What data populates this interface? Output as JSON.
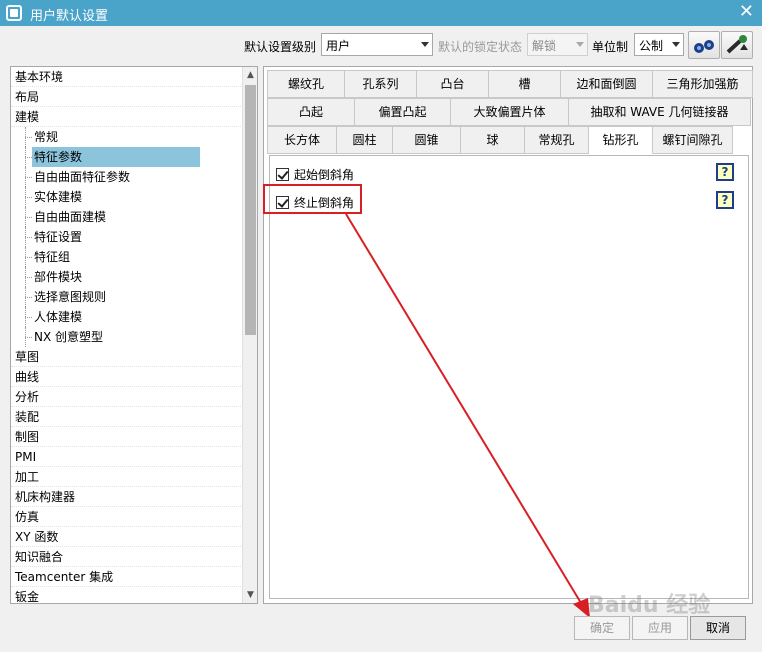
{
  "window": {
    "title": "用户默认设置",
    "close_label": "✕"
  },
  "toolbar": {
    "level_label": "默认设置级别",
    "level_value": "用户",
    "lock_label": "默认的锁定状态",
    "lock_value": "解锁",
    "unit_label": "单位制",
    "unit_value": "公制"
  },
  "tree": {
    "items": [
      {
        "label": "基本环境",
        "level": 0
      },
      {
        "label": "布局",
        "level": 0
      },
      {
        "label": "建模",
        "level": 0
      },
      {
        "label": "常规",
        "level": 1
      },
      {
        "label": "特征参数",
        "level": 1,
        "selected": true
      },
      {
        "label": "自由曲面特征参数",
        "level": 1
      },
      {
        "label": "实体建模",
        "level": 1
      },
      {
        "label": "自由曲面建模",
        "level": 1
      },
      {
        "label": "特征设置",
        "level": 1
      },
      {
        "label": "特征组",
        "level": 1
      },
      {
        "label": "部件模块",
        "level": 1
      },
      {
        "label": "选择意图规则",
        "level": 1
      },
      {
        "label": "人体建模",
        "level": 1
      },
      {
        "label": "NX 创意塑型",
        "level": 1
      },
      {
        "label": "草图",
        "level": 0
      },
      {
        "label": "曲线",
        "level": 0
      },
      {
        "label": "分析",
        "level": 0
      },
      {
        "label": "装配",
        "level": 0
      },
      {
        "label": "制图",
        "level": 0
      },
      {
        "label": "PMI",
        "level": 0
      },
      {
        "label": "加工",
        "level": 0
      },
      {
        "label": "机床构建器",
        "level": 0
      },
      {
        "label": "仿真",
        "level": 0
      },
      {
        "label": "XY 函数",
        "level": 0
      },
      {
        "label": "知识融合",
        "level": 0
      },
      {
        "label": "Teamcenter 集成",
        "level": 0
      },
      {
        "label": "钣金",
        "level": 0
      }
    ]
  },
  "tabs": {
    "row1": [
      "螺纹孔",
      "孔系列",
      "凸台",
      "槽",
      "边和面倒圆",
      "三角形加强筋"
    ],
    "row2": [
      "凸起",
      "偏置凸起",
      "大致偏置片体",
      "抽取和 WAVE 几何链接器"
    ],
    "row3": [
      "长方体",
      "圆柱",
      "圆锥",
      "球",
      "常规孔",
      "钻形孔",
      "螺钉间隙孔"
    ],
    "active": "钻形孔"
  },
  "options": [
    {
      "label": "起始倒斜角",
      "checked": true,
      "help": "?"
    },
    {
      "label": "终止倒斜角",
      "checked": true,
      "help": "?"
    }
  ],
  "buttons": {
    "ok": "确定",
    "apply": "应用",
    "cancel": "取消"
  },
  "watermark": "Baidu 经验",
  "colors": {
    "titlebar": "#4aa3c8",
    "selected": "#8cc4dc",
    "annotation": "#d81f26"
  }
}
